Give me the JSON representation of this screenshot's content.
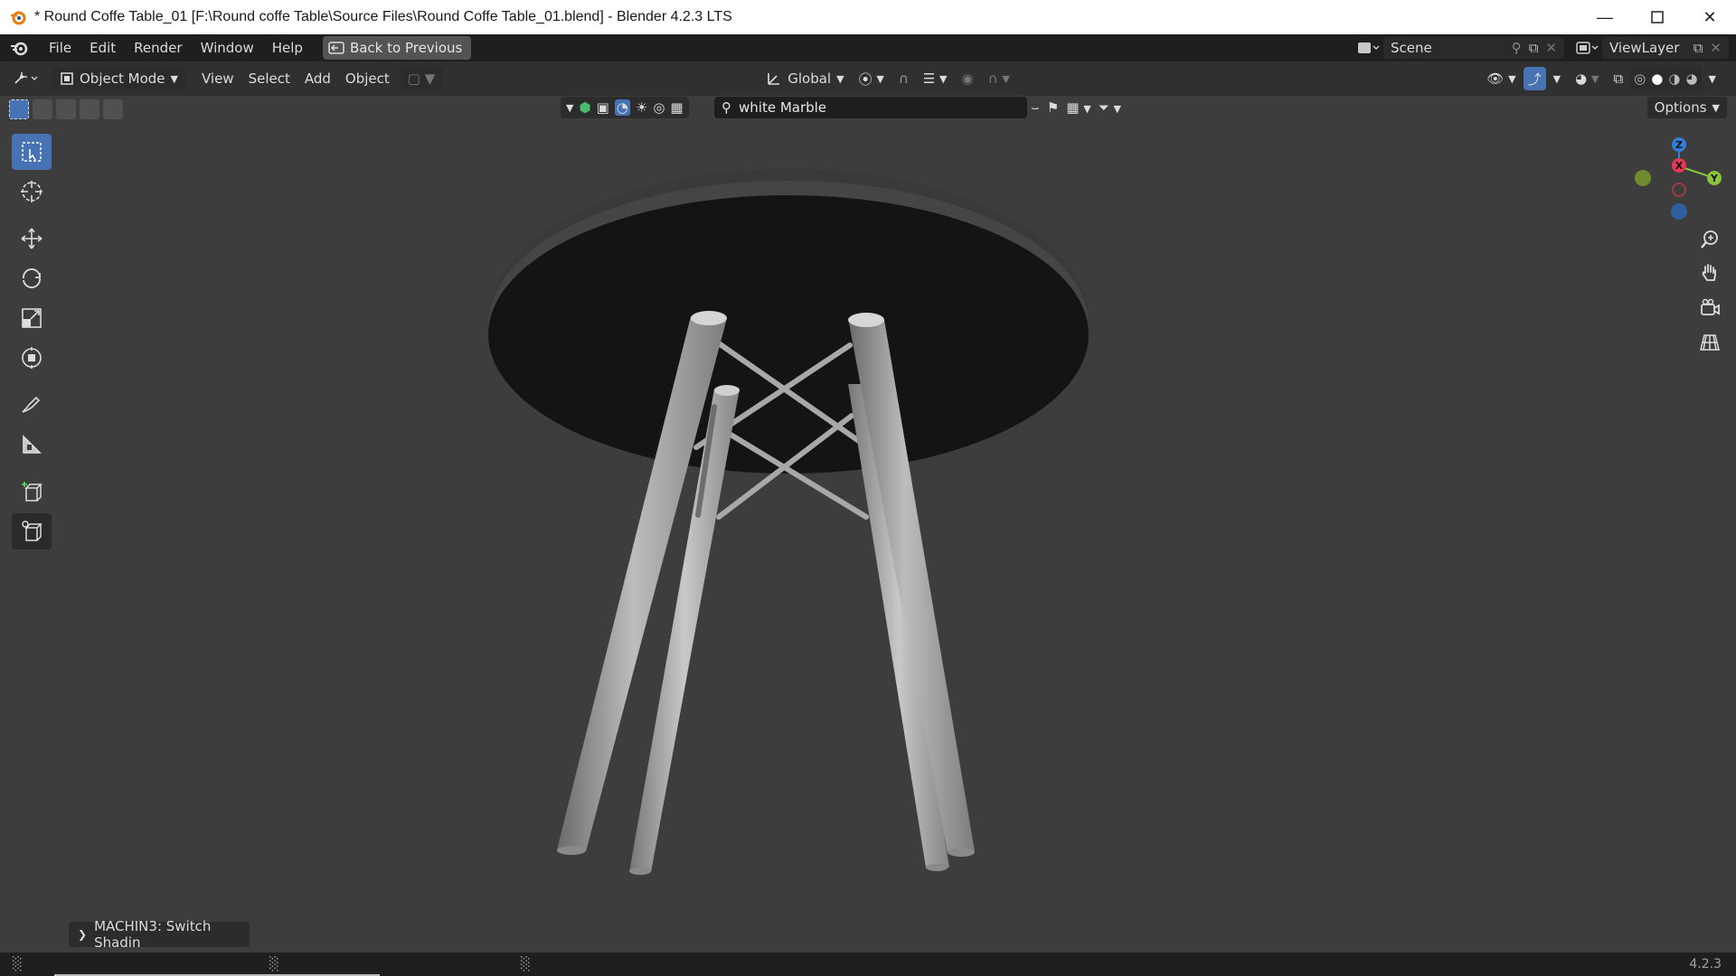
{
  "window": {
    "title": "* Round Coffe Table_01 [F:\\Round coffe Table\\Source Files\\Round Coffe Table_01.blend] - Blender 4.2.3 LTS"
  },
  "menubar": {
    "items": [
      "File",
      "Edit",
      "Render",
      "Window",
      "Help"
    ],
    "back_button": "Back to Previous",
    "scene": "Scene",
    "view_layer": "ViewLayer"
  },
  "header": {
    "mode": "Object Mode",
    "menus": [
      "View",
      "Select",
      "Add",
      "Object"
    ],
    "transform_orientation": "Global"
  },
  "subheader": {
    "search_value": "white Marble",
    "options_label": "Options"
  },
  "gizmo": {
    "z_label": "Z",
    "x_label": "X",
    "y_label": "Y",
    "x_color": "#e5394f",
    "y_color": "#8bc33a",
    "z_color": "#2f7fd6"
  },
  "operator_panel": {
    "label": "MACHIN3: Switch Shadin"
  },
  "status": {
    "version": "4.2.3"
  },
  "colors": {
    "accent": "#4772b3",
    "viewport_bg": "#3d3d3d",
    "header_bg": "#303030",
    "topbar_bg": "#1f1f1f"
  }
}
